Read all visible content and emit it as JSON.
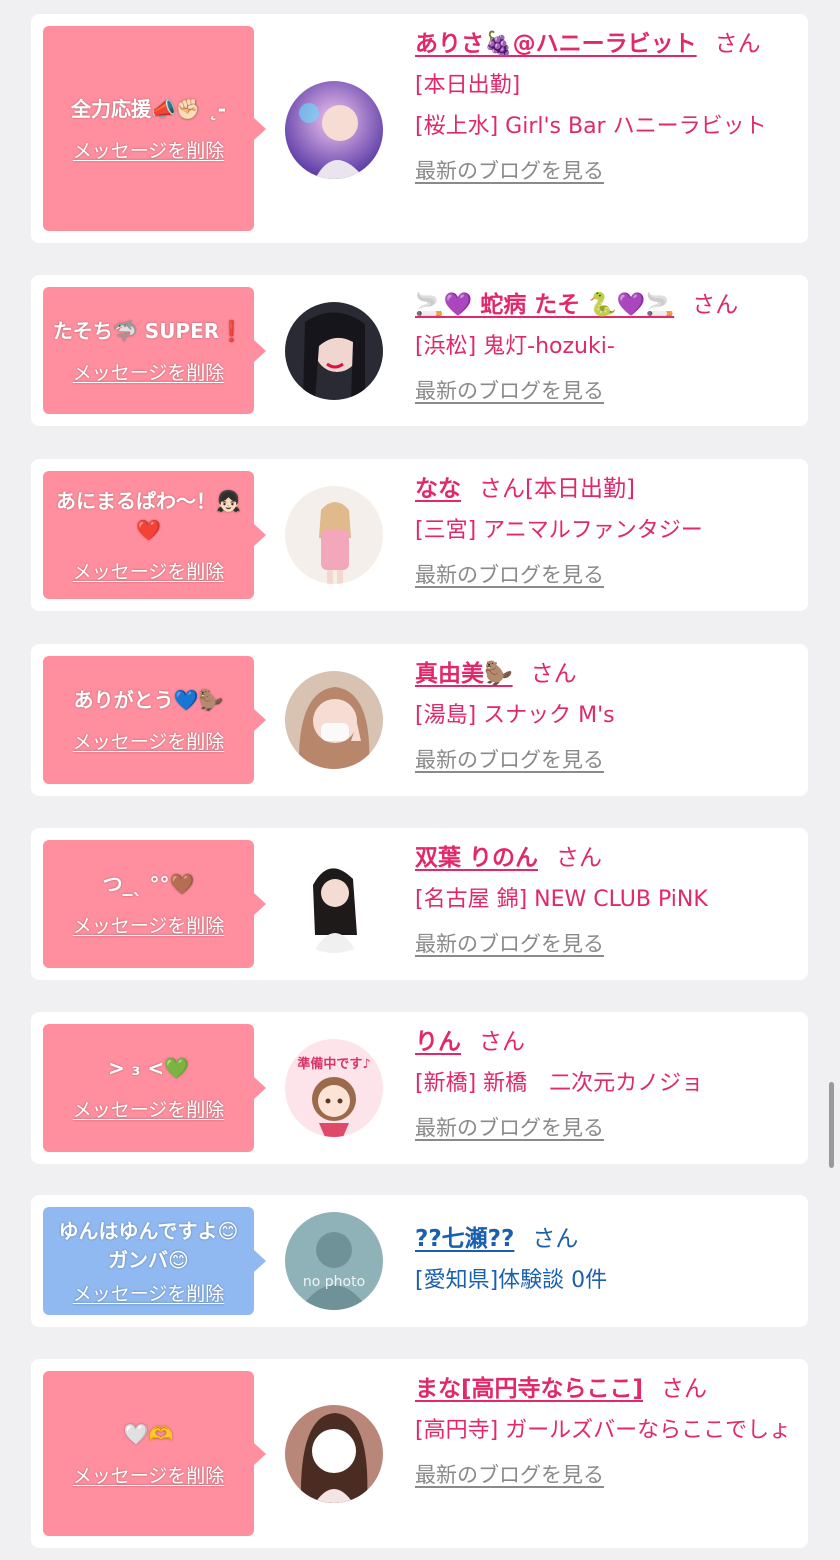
{
  "delete_label": "メッセージを削除",
  "blog_label": "最新のブログを見る",
  "honorific": "さん",
  "entries": [
    {
      "message": "全力応援📣✊🏻 ˛-",
      "name": "ありさ🍇@ハニーラビット",
      "name_suffix": "",
      "lines": [
        "[本日出勤]",
        "[桜上水] Girl's Bar ハニーラビット"
      ]
    },
    {
      "message": "たそち🦈 SUPER❗️",
      "name": "🚬💜 蛇病 たそ 🐍💜🚬",
      "name_suffix": "",
      "lines": [
        "[浜松] 鬼灯-hozuki-"
      ]
    },
    {
      "message": "あにまるぱわ〜！👧🏻❤️",
      "name": "なな",
      "name_suffix": "[本日出勤]",
      "lines": [
        "[三宮] アニマルファンタジー"
      ]
    },
    {
      "message": "ありがとう💙🦫",
      "name": "真由美🦫",
      "name_suffix": "",
      "lines": [
        "[湯島] スナック M's"
      ]
    },
    {
      "message": "つ_ˎ °°🤎",
      "name": "双葉 りのん",
      "name_suffix": "",
      "lines": [
        "[名古屋 錦] NEW CLUB PiNK"
      ]
    },
    {
      "message": "> ₃ <💚",
      "name": "りん",
      "name_suffix": "",
      "avatar_text": "準備中です♪",
      "lines": [
        "[新橋] 新橋　二次元カノジョ"
      ]
    },
    {
      "message": "ゆんはゆんですよ😊ガンバ😊",
      "name": "??七瀬??",
      "name_suffix": "",
      "avatar_text": "no photo",
      "lines": [
        "[愛知県]体験談 0件"
      ]
    },
    {
      "message": "🤍🫶",
      "name": "まな[高円寺ならここ]",
      "name_suffix": "",
      "lines": [
        "[高円寺] ガールズバーならここでしょ"
      ]
    }
  ]
}
